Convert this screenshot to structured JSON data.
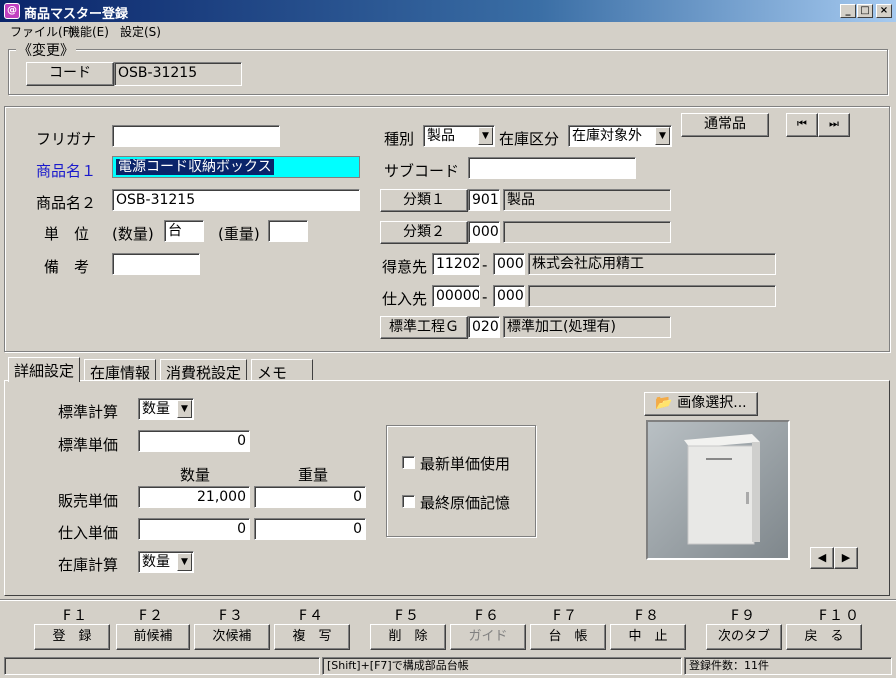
{
  "window": {
    "title": "商品マスター登録",
    "app_icon": "app-icon"
  },
  "menu": {
    "items": [
      "ファイル(F)",
      "機能(E)",
      "設定(S)"
    ]
  },
  "mode": {
    "label": "《変更》"
  },
  "code": {
    "button": "コード",
    "value": "OSB-31215"
  },
  "left": {
    "furigana_label": "フリガナ",
    "furigana_value": "",
    "name1_label": "商品名１",
    "name1_value": "電源コード収納ボックス",
    "name2_label": "商品名２",
    "name2_value": "OSB-31215",
    "unit_label": "単　位",
    "qty_label": "(数量)",
    "qty_value": "台",
    "weight_label": "(重量)",
    "weight_value": "",
    "remarks_label": "備　考",
    "remarks_value": ""
  },
  "right": {
    "kind_label": "種別",
    "kind_value": "製品",
    "stock_label": "在庫区分",
    "stock_value": "在庫対象外",
    "normal_button": "通常品",
    "subcode_label": "サブコード",
    "subcode_value": "",
    "cat1_button": "分類１",
    "cat1_code": "901",
    "cat1_name": "製品",
    "cat2_button": "分類２",
    "cat2_code": "000",
    "cat2_name": "",
    "customer_label": "得意先",
    "customer_code1": "11202",
    "dash": "-",
    "customer_code2": "000",
    "customer_name": "株式会社応用精工",
    "supplier_label": "仕入先",
    "supplier_code1": "00000",
    "supplier_code2": "000",
    "supplier_name": "",
    "process_button": "標準工程Ｇ",
    "process_code": "020",
    "process_name": "標準加工(処理有)",
    "nav_first": "⏮",
    "nav_last": "⏭"
  },
  "tabs": [
    {
      "label": "詳細設定",
      "active": true
    },
    {
      "label": "在庫情報",
      "active": false
    },
    {
      "label": "消費税設定",
      "active": false
    },
    {
      "label": "メモ",
      "active": false
    }
  ],
  "detail": {
    "std_calc_label": "標準計算",
    "std_calc_value": "数量",
    "std_price_label": "標準単価",
    "std_price_value": "0",
    "qty_header": "数量",
    "weight_header": "重量",
    "sales_label": "販売単価",
    "sales_qty": "21,000",
    "sales_weight": "0",
    "purchase_label": "仕入単価",
    "purchase_qty": "0",
    "purchase_weight": "0",
    "stock_calc_label": "在庫計算",
    "stock_calc_value": "数量",
    "latest_price_label": "最新単価使用",
    "last_cost_label": "最終原価記憶",
    "image_button": "画像選択...",
    "prev": "◀",
    "next": "▶"
  },
  "fkeys": [
    {
      "key": "F１",
      "label": "登　録",
      "enabled": true
    },
    {
      "key": "F２",
      "label": "前候補",
      "enabled": true
    },
    {
      "key": "F３",
      "label": "次候補",
      "enabled": true
    },
    {
      "key": "F４",
      "label": "複　写",
      "enabled": true
    },
    {
      "key": "F５",
      "label": "削　除",
      "enabled": true
    },
    {
      "key": "F６",
      "label": "ガイド",
      "enabled": false
    },
    {
      "key": "F７",
      "label": "台　帳",
      "enabled": true
    },
    {
      "key": "F８",
      "label": "中　止",
      "enabled": true
    },
    {
      "key": "F９",
      "label": "次のタブ",
      "enabled": true
    },
    {
      "key": "F１０",
      "label": "戻　る",
      "enabled": true
    }
  ],
  "status": {
    "hint": "[Shift]+[F7]で構成部品台帳",
    "count": "登録件数：11件"
  }
}
